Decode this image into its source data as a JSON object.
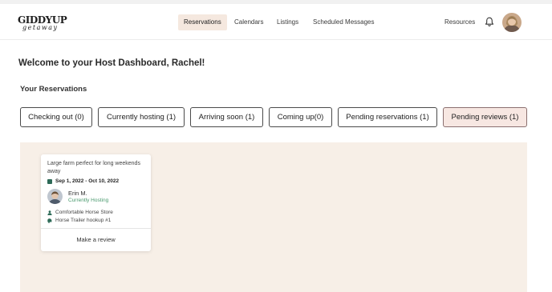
{
  "brand": {
    "logo_main": "GIDDYUP",
    "logo_sub": "getaway"
  },
  "nav": {
    "items": [
      {
        "label": "Reservations",
        "active": true
      },
      {
        "label": "Calendars"
      },
      {
        "label": "Listings"
      },
      {
        "label": "Scheduled Messages"
      }
    ],
    "resources_label": "Resources",
    "icons": {
      "bell": "bell-icon",
      "avatar": "user-avatar"
    }
  },
  "page": {
    "welcome": "Welcome to your Host Dashboard, Rachel!",
    "section_title": "Your Reservations"
  },
  "tabs": [
    {
      "label": "Checking out (0)"
    },
    {
      "label": "Currently hosting (1)"
    },
    {
      "label": "Arriving soon (1)"
    },
    {
      "label": "Coming up(0)"
    },
    {
      "label": "Pending reservations (1)"
    },
    {
      "label": "Pending reviews (1)",
      "active": true
    }
  ],
  "reservation_card": {
    "title": "Large farm perfect for long weekends away",
    "dates": "Sep 1, 2022 -  Oct 10, 2022",
    "guest_name": "Erin M.",
    "guest_status": "Currently Hosting",
    "meta": [
      {
        "icon": "person-icon",
        "text": "Comfortable Horse Store"
      },
      {
        "icon": "trailer-icon",
        "text": "Horse Trailer hookup #1"
      }
    ],
    "action_label": "Make a review"
  },
  "colors": {
    "accent_bg": "#f5e8df",
    "panel_bg": "#f7efe7",
    "status_green": "#4a9a6e",
    "icon_green": "#2d6a57",
    "active_tab_bg": "#f7e7e2"
  }
}
